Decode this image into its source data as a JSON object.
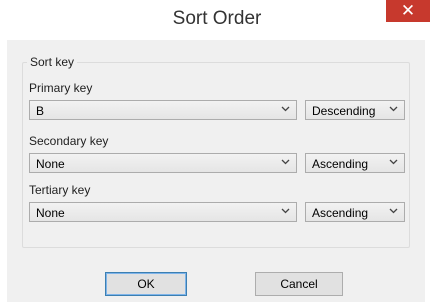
{
  "window": {
    "title": "Sort Order",
    "close_glyph": "✕"
  },
  "group": {
    "label": "Sort key"
  },
  "primary": {
    "label": "Primary key",
    "column": "B",
    "order": "Descending"
  },
  "secondary": {
    "label": "Secondary key",
    "column": "None",
    "order": "Ascending"
  },
  "tertiary": {
    "label": "Tertiary key",
    "column": "None",
    "order": "Ascending"
  },
  "buttons": {
    "ok": "OK",
    "cancel": "Cancel"
  },
  "icons": {
    "close": "close-icon",
    "dropdown": "chevron-down-icon"
  },
  "colors": {
    "close_button": "#c7392d",
    "client_background": "#f0f0f0",
    "default_button_border": "#3c7fb1"
  }
}
